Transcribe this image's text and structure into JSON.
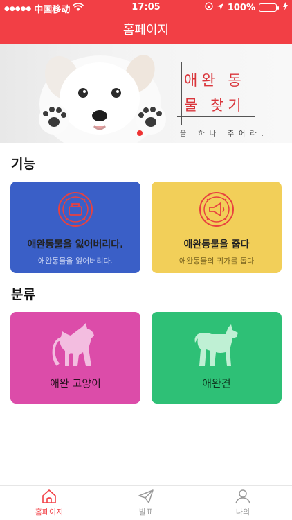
{
  "status_bar": {
    "carrier": "中国移动",
    "time": "17:05",
    "battery": "100%"
  },
  "header": {
    "title": "홈페이지"
  },
  "banner": {
    "line1": "애완 동",
    "line2": "물 찾기",
    "line3": "울 하나 주어라.",
    "active_slide": 1
  },
  "sections": {
    "function_title": "기능",
    "category_title": "분류"
  },
  "cards": {
    "lost": {
      "main": "애완동물을 잃어버리다.",
      "sub": "애완동물을 잃어버리다.",
      "color": "#3a5fc7"
    },
    "found": {
      "main": "애완동물을 줍다",
      "sub": "애완동물의 귀가를 돕다",
      "color": "#f2cf59"
    },
    "cat": {
      "main": "애완 고양이",
      "color": "#dc4ca9"
    },
    "dog": {
      "main": "애완견",
      "color": "#2ec076"
    }
  },
  "tabs": [
    {
      "label": "홈페이지",
      "icon": "home-icon",
      "active": true
    },
    {
      "label": "발표",
      "icon": "paper-plane-icon",
      "active": false
    },
    {
      "label": "나의",
      "icon": "person-icon",
      "active": false
    }
  ]
}
